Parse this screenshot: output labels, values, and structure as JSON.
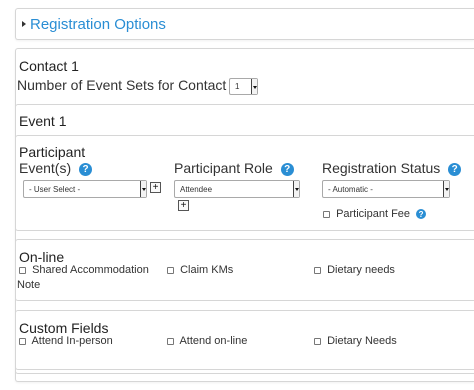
{
  "registration_options": {
    "label": "Registration Options"
  },
  "contact": {
    "title": "Contact 1",
    "event_sets_label": "Number of Event Sets for Contact 1",
    "event_sets_value": "1"
  },
  "event": {
    "title": "Event 1"
  },
  "participant": {
    "title": "Participant",
    "events_label": "Event(s)",
    "events_select": "- User Select -",
    "role_label": "Participant Role",
    "role_select": "Attendee",
    "status_label": "Registration Status",
    "status_select": "- Automatic -",
    "fee_label": "Participant Fee",
    "help_glyph": "?",
    "plus_glyph": "+"
  },
  "online": {
    "title": "On-line",
    "shared_accommodation": "Shared Accommodation",
    "claim_kms": "Claim KMs",
    "dietary_needs": "Dietary needs",
    "note_label": "Note"
  },
  "custom_fields": {
    "title": "Custom Fields",
    "attend_in_person": "Attend In-person",
    "attend_online": "Attend on-line",
    "dietary_needs": "Dietary Needs"
  },
  "colors": {
    "link": "#2a8ed4",
    "help": "#2a8ed4",
    "border": "#d6d6d6"
  }
}
